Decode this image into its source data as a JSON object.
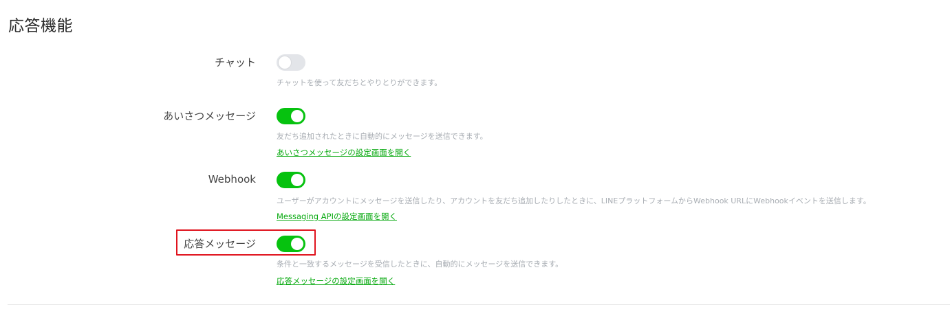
{
  "page": {
    "title": "応答機能"
  },
  "settings": [
    {
      "label": "チャット",
      "enabled": false,
      "description": "チャットを使って友だちとやりとりができます。",
      "link": ""
    },
    {
      "label": "あいさつメッセージ",
      "enabled": true,
      "description": "友だち追加されたときに自動的にメッセージを送信できます。",
      "link": "あいさつメッセージの設定画面を開く"
    },
    {
      "label": "Webhook",
      "enabled": true,
      "description": "ユーザーがアカウントにメッセージを送信したり、アカウントを友だち追加したりしたときに、LINEプラットフォームからWebhook URLにWebhookイベントを送信します。",
      "link": "Messaging APIの設定画面を開く"
    },
    {
      "label": "応答メッセージ",
      "enabled": true,
      "description": "条件と一致するメッセージを受信したときに、自動的にメッセージを送信できます。",
      "link": "応答メッセージの設定画面を開く"
    }
  ],
  "colors": {
    "toggle_on": "#06c20f",
    "toggle_off": "#e3e5e9",
    "link": "#06a90e",
    "highlight": "#e0141e"
  },
  "icons": {
    "toggle": "toggle-switch-icon"
  }
}
